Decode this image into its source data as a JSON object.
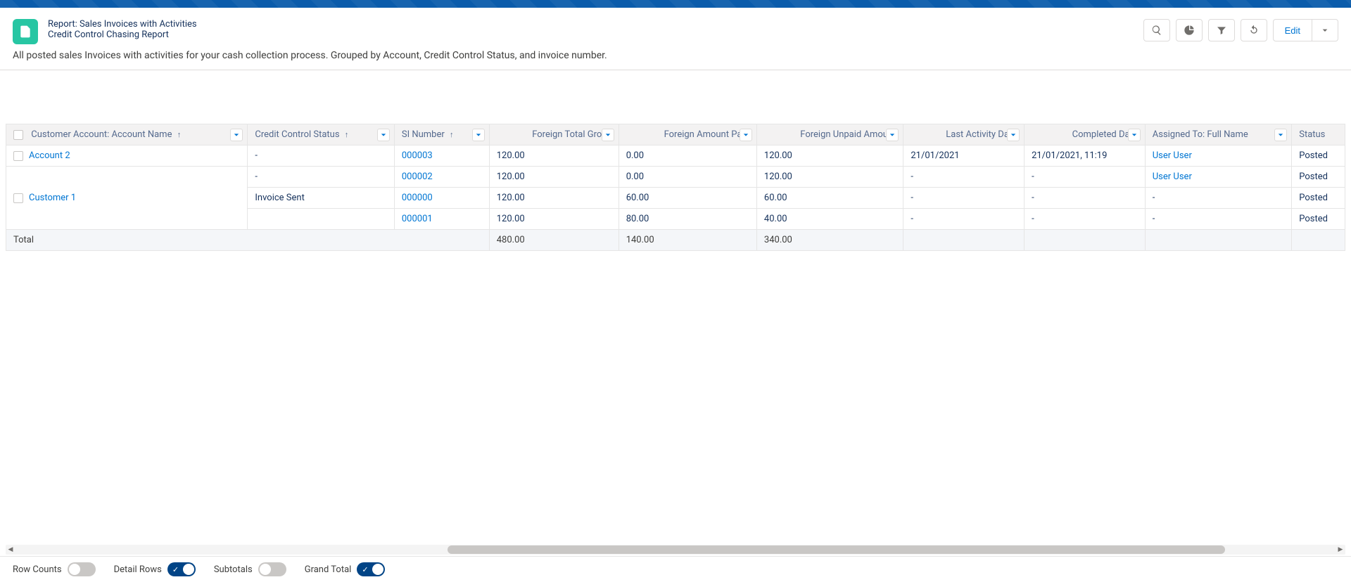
{
  "header": {
    "overline": "Report: Sales Invoices with Activities",
    "title": "Credit Control Chasing Report",
    "description": "All posted sales Invoices with activities for your cash collection process. Grouped by Account, Credit Control Status, and invoice number.",
    "editLabel": "Edit"
  },
  "columns": [
    {
      "label": "Customer Account: Account Name",
      "sort": "asc"
    },
    {
      "label": "Credit Control Status",
      "sort": "asc"
    },
    {
      "label": "SI Number",
      "sort": "asc"
    },
    {
      "label": "Foreign Total Gross"
    },
    {
      "label": "Foreign Amount Paid"
    },
    {
      "label": "Foreign Unpaid Amount"
    },
    {
      "label": "Last Activity Date"
    },
    {
      "label": "Completed Date"
    },
    {
      "label": "Assigned To: Full Name"
    },
    {
      "label": "Status"
    }
  ],
  "rows": [
    {
      "account": "Account 2",
      "ccStatus": "-",
      "si": "000003",
      "gross": "120.00",
      "paid": "0.00",
      "unpaid": "120.00",
      "lastActivity": "21/01/2021",
      "completed": "21/01/2021, 11:19",
      "assigned": "User User",
      "status": "Posted",
      "firstOfGroup": true,
      "groupSpan": 1
    },
    {
      "account": "Customer 1",
      "ccStatus": "-",
      "si": "000002",
      "gross": "120.00",
      "paid": "0.00",
      "unpaid": "120.00",
      "lastActivity": "-",
      "completed": "-",
      "assigned": "User User",
      "status": "Posted",
      "firstOfGroup": true,
      "groupSpan": 3
    },
    {
      "account": "",
      "ccStatus": "Invoice Sent",
      "si": "000000",
      "gross": "120.00",
      "paid": "60.00",
      "unpaid": "60.00",
      "lastActivity": "-",
      "completed": "-",
      "assigned": "-",
      "status": "Posted"
    },
    {
      "account": "",
      "ccStatus": "",
      "si": "000001",
      "gross": "120.00",
      "paid": "80.00",
      "unpaid": "40.00",
      "lastActivity": "-",
      "completed": "-",
      "assigned": "-",
      "status": "Posted"
    }
  ],
  "total": {
    "label": "Total",
    "gross": "480.00",
    "paid": "140.00",
    "unpaid": "340.00"
  },
  "footer": {
    "rowCounts": {
      "label": "Row Counts",
      "on": false
    },
    "detailRows": {
      "label": "Detail Rows",
      "on": true
    },
    "subtotals": {
      "label": "Subtotals",
      "on": false
    },
    "grandTotal": {
      "label": "Grand Total",
      "on": true
    }
  }
}
